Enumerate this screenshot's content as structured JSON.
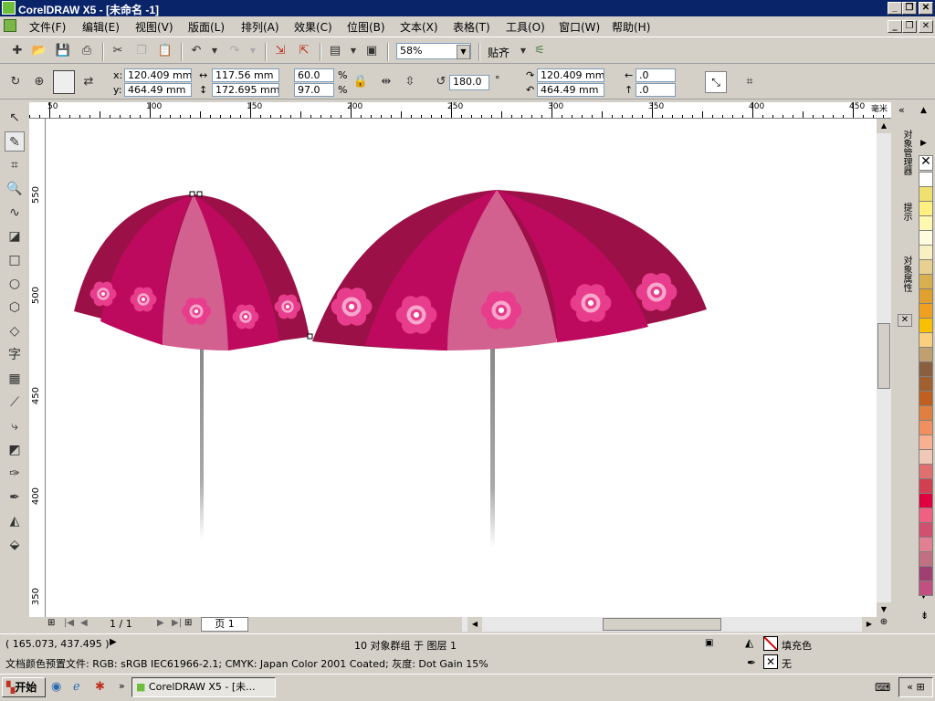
{
  "window": {
    "title": "CorelDRAW X5 - [未命名 -1]",
    "minimize": "_",
    "restore": "❐",
    "close": "✕"
  },
  "menu": [
    "文件(F)",
    "编辑(E)",
    "视图(V)",
    "版面(L)",
    "排列(A)",
    "效果(C)",
    "位图(B)",
    "文本(X)",
    "表格(T)",
    "工具(O)",
    "窗口(W)",
    "帮助(H)"
  ],
  "toolbar": {
    "zoom": "58%",
    "snap": "贴齐"
  },
  "propbar": {
    "x_label": "x:",
    "y_label": "y:",
    "x": "120.409 mm",
    "y": "464.49 mm",
    "w": "117.56 mm",
    "h": "172.695 mm",
    "scale_w": "60.0",
    "scale_h": "97.0",
    "pct": "%",
    "rotation": "180.0",
    "deg": "°",
    "cx": "120.409 mm",
    "cy": "464.49 mm",
    "skew_h": ".0",
    "skew_v": ".0"
  },
  "ruler": {
    "unit": "毫米",
    "h_ticks": [
      "50",
      "100",
      "150",
      "200",
      "250",
      "300",
      "350",
      "400",
      "450"
    ],
    "v_ticks": [
      "550",
      "500",
      "450",
      "400",
      "350"
    ]
  },
  "pages": {
    "counter": "1 / 1",
    "tab": "页 1"
  },
  "dockers": {
    "obj_manager": "对象管理器",
    "hints": "提示",
    "obj_props": "对象属性"
  },
  "status": {
    "coords": "( 165.073, 437.495 )",
    "selection": "10 对象群组 于 图层 1",
    "color_profile": "文档颜色预置文件: RGB: sRGB IEC61966-2.1; CMYK: Japan Color 2001 Coated; 灰度: Dot Gain 15%",
    "fill_label": "填充色",
    "outline_label": "无"
  },
  "taskbar": {
    "start": "开始",
    "task": "CorelDRAW X5 - [未..."
  },
  "palette": [
    "#ffffff",
    "#f0e070",
    "#fff080",
    "#fff8b0",
    "#fffce0",
    "#f8f0c0",
    "#e8d090",
    "#d8b050",
    "#e0a030",
    "#f0a020",
    "#f8c000",
    "#f8d080",
    "#c0a070",
    "#886040",
    "#a06030",
    "#c06020",
    "#e08040",
    "#f09060",
    "#f8b090",
    "#f0c8b8",
    "#e07070",
    "#d04050",
    "#e00040",
    "#f06080",
    "#d05070",
    "#e08090",
    "#c07080",
    "#a04070",
    "#c05080"
  ],
  "colors": {
    "umbrella_dark": "#9b1046",
    "umbrella_mid": "#bd0a5e",
    "umbrella_light": "#d36190",
    "flower": "#e83d8c",
    "flower_light": "#f7a8cc"
  }
}
